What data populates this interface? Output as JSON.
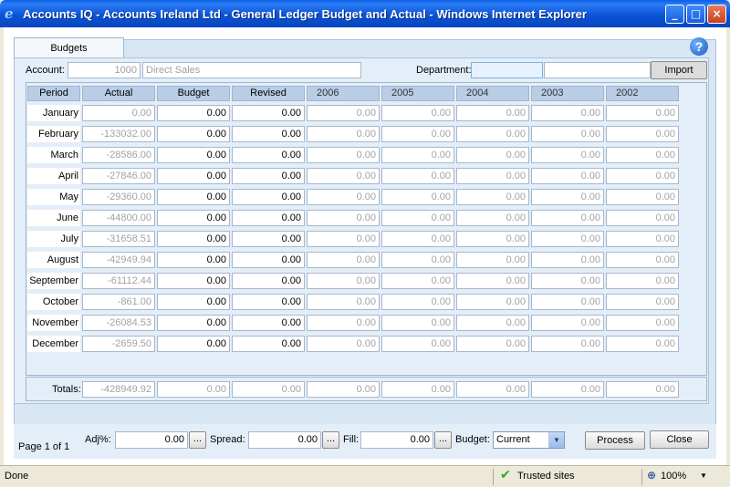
{
  "window": {
    "title": "Accounts IQ - Accounts Ireland Ltd - General Ledger Budget and Actual - Windows Internet Explorer",
    "min_glyph": "_",
    "max_glyph": "□",
    "close_glyph": "×"
  },
  "tab": {
    "label": "Budgets"
  },
  "help": {
    "glyph": "?"
  },
  "account": {
    "label": "Account:",
    "code": "1000",
    "name": "Direct Sales"
  },
  "department": {
    "label": "Department:",
    "code": "",
    "name": ""
  },
  "import_button": "Import",
  "columns": [
    "Period",
    "Actual",
    "Budget",
    "Revised",
    "2006",
    "2005",
    "2004",
    "2003",
    "2002"
  ],
  "rows": [
    {
      "period": "January",
      "actual": "0.00",
      "budget": "0.00",
      "revised": "0.00",
      "y2006": "0.00",
      "y2005": "0.00",
      "y2004": "0.00",
      "y2003": "0.00",
      "y2002": "0.00"
    },
    {
      "period": "February",
      "actual": "-133032.00",
      "budget": "0.00",
      "revised": "0.00",
      "y2006": "0.00",
      "y2005": "0.00",
      "y2004": "0.00",
      "y2003": "0.00",
      "y2002": "0.00"
    },
    {
      "period": "March",
      "actual": "-28586.00",
      "budget": "0.00",
      "revised": "0.00",
      "y2006": "0.00",
      "y2005": "0.00",
      "y2004": "0.00",
      "y2003": "0.00",
      "y2002": "0.00"
    },
    {
      "period": "April",
      "actual": "-27846.00",
      "budget": "0.00",
      "revised": "0.00",
      "y2006": "0.00",
      "y2005": "0.00",
      "y2004": "0.00",
      "y2003": "0.00",
      "y2002": "0.00"
    },
    {
      "period": "May",
      "actual": "-29360.00",
      "budget": "0.00",
      "revised": "0.00",
      "y2006": "0.00",
      "y2005": "0.00",
      "y2004": "0.00",
      "y2003": "0.00",
      "y2002": "0.00"
    },
    {
      "period": "June",
      "actual": "-44800.00",
      "budget": "0.00",
      "revised": "0.00",
      "y2006": "0.00",
      "y2005": "0.00",
      "y2004": "0.00",
      "y2003": "0.00",
      "y2002": "0.00"
    },
    {
      "period": "July",
      "actual": "-31658.51",
      "budget": "0.00",
      "revised": "0.00",
      "y2006": "0.00",
      "y2005": "0.00",
      "y2004": "0.00",
      "y2003": "0.00",
      "y2002": "0.00"
    },
    {
      "period": "August",
      "actual": "-42949.94",
      "budget": "0.00",
      "revised": "0.00",
      "y2006": "0.00",
      "y2005": "0.00",
      "y2004": "0.00",
      "y2003": "0.00",
      "y2002": "0.00"
    },
    {
      "period": "September",
      "actual": "-61112.44",
      "budget": "0.00",
      "revised": "0.00",
      "y2006": "0.00",
      "y2005": "0.00",
      "y2004": "0.00",
      "y2003": "0.00",
      "y2002": "0.00"
    },
    {
      "period": "October",
      "actual": "-861.00",
      "budget": "0.00",
      "revised": "0.00",
      "y2006": "0.00",
      "y2005": "0.00",
      "y2004": "0.00",
      "y2003": "0.00",
      "y2002": "0.00"
    },
    {
      "period": "November",
      "actual": "-26084.53",
      "budget": "0.00",
      "revised": "0.00",
      "y2006": "0.00",
      "y2005": "0.00",
      "y2004": "0.00",
      "y2003": "0.00",
      "y2002": "0.00"
    },
    {
      "period": "December",
      "actual": "-2659.50",
      "budget": "0.00",
      "revised": "0.00",
      "y2006": "0.00",
      "y2005": "0.00",
      "y2004": "0.00",
      "y2003": "0.00",
      "y2002": "0.00"
    }
  ],
  "totals": {
    "label": "Totals:",
    "actual": "-428949.92",
    "budget": "0.00",
    "revised": "0.00",
    "y2006": "0.00",
    "y2005": "0.00",
    "y2004": "0.00",
    "y2003": "0.00",
    "y2002": "0.00"
  },
  "bottom": {
    "page": "Page 1 of 1",
    "adj_label": "Adj%:",
    "adj_value": "0.00",
    "spread_label": "Spread:",
    "spread_value": "0.00",
    "fill_label": "Fill:",
    "fill_value": "0.00",
    "ellipsis": "...",
    "budget_label": "Budget:",
    "budget_value": "Current",
    "process_button": "Process",
    "close_button": "Close"
  },
  "statusbar": {
    "text": "Done",
    "zone": "Trusted sites",
    "zoom": "100%",
    "check_glyph": "✔",
    "zoom_glyph": "⊕",
    "dropdown_glyph": "▼"
  },
  "colors": {
    "titlebar": "#0a54d8",
    "panel": "#e4eef8",
    "header": "#b9cde6",
    "disabled_text": "#a3a3a3"
  }
}
